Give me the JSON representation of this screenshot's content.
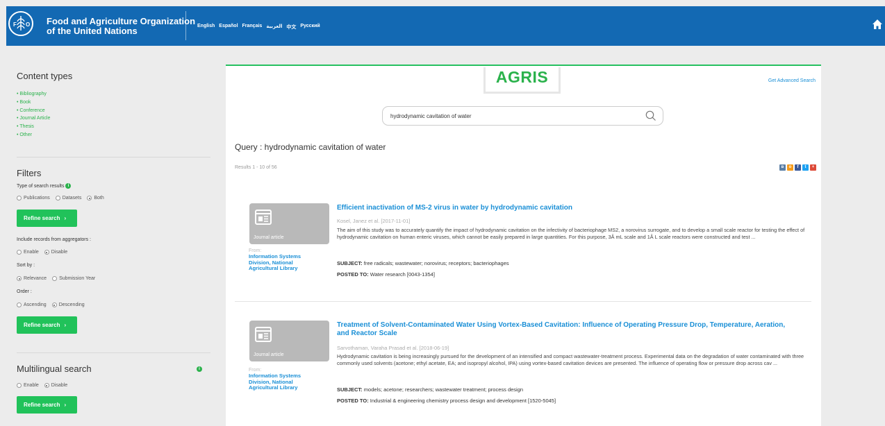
{
  "header": {
    "org_line1": "Food and Agriculture Organization",
    "org_line2": "of the United Nations",
    "languages": [
      "English",
      "Español",
      "Français",
      "العربية",
      "中文",
      "Русский"
    ],
    "bar_color": "#1369b3"
  },
  "sidebar": {
    "content_types_title": "Content types",
    "content_types": [
      "Bibliography",
      "Book",
      "Conference",
      "Journal Article",
      "Thesis",
      "Other"
    ],
    "filters_title": "Filters",
    "type_label": "Type of search results",
    "type_options": [
      "Publications",
      "Datasets",
      "Both"
    ],
    "type_selected": "Both",
    "refine_label": "Refine search",
    "aggregators_label": "Include records from aggregators :",
    "agg_options": [
      "Enable",
      "Disable"
    ],
    "agg_selected": "Disable",
    "sort_label": "Sort by :",
    "sort_options": [
      "Relevance",
      "Submission Year"
    ],
    "sort_selected": "Relevance",
    "order_label": "Order :",
    "order_options": [
      "Ascending",
      "Descending"
    ],
    "order_selected": "Descending",
    "multilingual_title": "Multilingual search",
    "ml_options": [
      "Enable",
      "Disable"
    ],
    "ml_selected": "Disable",
    "accent": "#21c25a"
  },
  "main": {
    "logo_text": "AGRIS",
    "advanced_link": "Get Advanced Search",
    "search_value": "hydrodynamic cavitation of water",
    "query_heading": "Query : hydrodynamic cavitation of water",
    "results_count": "Results 1 - 10 of 56",
    "share_icons": [
      "vk-icon",
      "ok-icon",
      "facebook-icon",
      "twitter-icon",
      "google-plus-icon"
    ],
    "records": [
      {
        "type_label": "Journal article",
        "from_label": "From:",
        "provider": "Information Systems Division, National Agricultural Library",
        "title": "Efficient inactivation of MS-2 virus in water by hydrodynamic cavitation",
        "authors": "Kosel, Janez et al. [2017-11-01]",
        "abstract": "The aim of this study was to accurately quantify the impact of hydrodynamic cavitation on the infectivity of bacteriophage MS2, a norovirus surrogate, and to develop a small scale reactor for testing the effect of hydrodynamic cavitation on human enteric viruses, which cannot be easily prepared in large quantities. For this purpose, 3Â mL scale and 1Â L scale reactors were constructed and test ...",
        "subject_label": "SUBJECT:",
        "subject": "free radicals; wastewater; norovirus; receptors; bacteriophages",
        "posted_label": "POSTED TO:",
        "posted": "Water research [0043-1354]"
      },
      {
        "type_label": "Journal article",
        "from_label": "From:",
        "provider": "Information Systems Division, National Agricultural Library",
        "title": "Treatment of Solvent-Contaminated Water Using Vortex-Based Cavitation: Influence of Operating Pressure Drop, Temperature, Aeration, and Reactor Scale",
        "authors": "Sarvothaman, Varaha Prasad et al. [2018-06-19]",
        "abstract": "Hydrodynamic cavitation is being increasingly pursued for the development of an intensified and compact wastewater-treatment process. Experimental data on the degradation of water contaminated with three commonly used solvents (acetone; ethyl acetate, EA; and isopropyl alcohol, IPA) using vortex-based cavitation devices are presented. The influence of operating flow or pressure drop across cav ...",
        "subject_label": "SUBJECT:",
        "subject": "models; acetone; researchers; wastewater treatment; process design",
        "posted_label": "POSTED TO:",
        "posted": "Industrial & engineering chemistry process design and development [1520-5045]"
      }
    ]
  }
}
